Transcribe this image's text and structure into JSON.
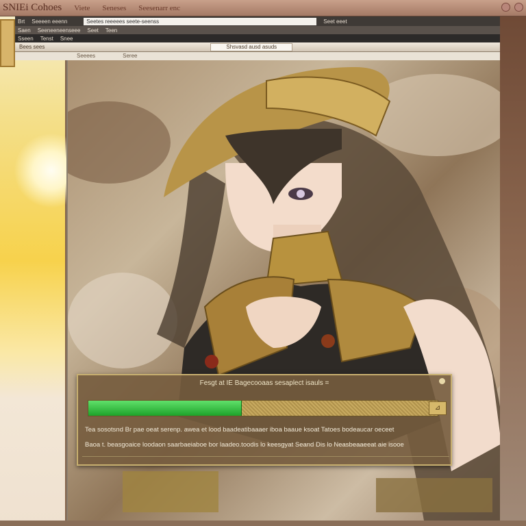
{
  "window": {
    "title": "SNIEi Cohoes",
    "menus": [
      "Viete",
      "Seneses",
      "Seesenarr enc"
    ]
  },
  "toolbar": {
    "row1_items": [
      "Brt",
      "Seeeen eeenn",
      "Seet eeet"
    ],
    "address": "Seetes reeeees seete-seenss",
    "row2_items": [
      "Saen",
      "Seeneeneenseee",
      "Seet",
      "Teen"
    ],
    "row3_items": [
      "Sseen",
      "Tenst",
      "Snee"
    ]
  },
  "tabs": {
    "left": "Bees sees",
    "active": "Shsvasd ausd asuds"
  },
  "subbar": {
    "items": [
      "Seeees",
      "Seree"
    ]
  },
  "dialog": {
    "title": "Fesgt at IE Bagecooaas sesaplect isauls =",
    "progress": 0.44,
    "button_label": "⊿",
    "line1": "Tea sosotsnd Br pae oeat serenp. awea et lood baadeatibaaaer iboa baaue ksoat Tatoes bodeaucar oeceet",
    "line2": "Baoa t. beasgoaice loodaon saarbaeiaboe bor laadeo.toodis lo keesgyat Seand Dis lo Neasbeaaeeat aie isooe"
  },
  "colors": {
    "progress_fill": "#1ea32a",
    "dialog_bg": "#765c3e",
    "titlebar": "#c9a08a"
  },
  "icons": {
    "close": "close-icon",
    "thumbnail": "image-thumbnail-icon"
  }
}
